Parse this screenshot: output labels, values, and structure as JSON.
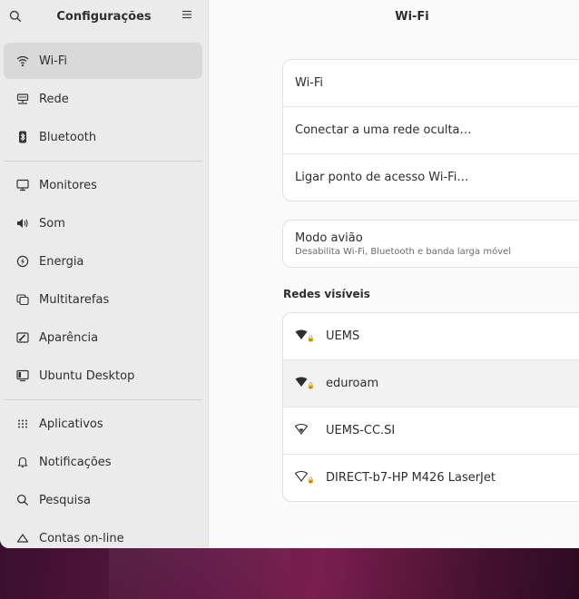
{
  "sidebar": {
    "title": "Configurações",
    "items": [
      {
        "label": "Wi-Fi",
        "icon": "wifi-icon",
        "active": true
      },
      {
        "label": "Rede",
        "icon": "network-icon"
      },
      {
        "label": "Bluetooth",
        "icon": "bluetooth-icon"
      },
      {
        "label": "Monitores",
        "icon": "monitor-icon"
      },
      {
        "label": "Som",
        "icon": "speaker-icon"
      },
      {
        "label": "Energia",
        "icon": "power-icon"
      },
      {
        "label": "Multitarefas",
        "icon": "multitasking-icon"
      },
      {
        "label": "Aparência",
        "icon": "appearance-icon"
      },
      {
        "label": "Ubuntu Desktop",
        "icon": "ubuntu-desktop-icon"
      },
      {
        "label": "Aplicativos",
        "icon": "apps-grid-icon"
      },
      {
        "label": "Notificações",
        "icon": "bell-icon"
      },
      {
        "label": "Pesquisa",
        "icon": "search-icon"
      },
      {
        "label": "Contas on-line",
        "icon": "cloud-icon"
      }
    ]
  },
  "main": {
    "title": "Wi-Fi",
    "wifi_card": {
      "wifi_label": "Wi-Fi",
      "hidden_network_label": "Conectar a uma rede oculta…",
      "hotspot_label": "Ligar ponto de acesso Wi-Fi…"
    },
    "airplane": {
      "label": "Modo avião",
      "description": "Desabilita Wi-Fi, Bluetooth e banda larga móvel"
    },
    "visible_networks_title": "Redes visíveis",
    "networks": [
      {
        "name": "UEMS",
        "signal": "strong",
        "secured": true
      },
      {
        "name": "eduroam",
        "signal": "strong",
        "secured": true
      },
      {
        "name": "UEMS-CC.SI",
        "signal": "weak",
        "secured": false
      },
      {
        "name": "DIRECT-b7-HP M426 LaserJet",
        "signal": "weak",
        "secured": true
      }
    ]
  }
}
